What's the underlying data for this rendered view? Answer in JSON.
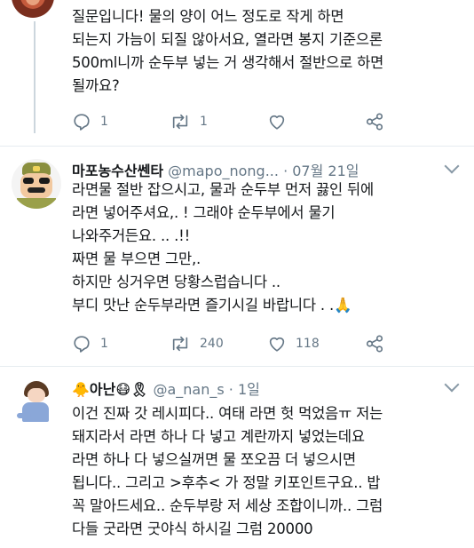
{
  "tweets": [
    {
      "text": "질문입니다! 물의 양이 어느 정도로 작게 하면\n되는지 가늠이 되질 않아서요, 열라면 봉지 기준으론\n500ml니까 순두부 넣는 거 생각해서 절반으로 하면\n될까요?",
      "actions": {
        "reply": "1",
        "retweet": "1",
        "like": ""
      }
    },
    {
      "display_name": "마포농수산쎈타",
      "handle": "@mapo_nong...",
      "dot": "·",
      "date": "07월 21일",
      "text": "라면물 절반 잡으시고, 물과 순두부 먼저 끓인 뒤에\n라면 넣어주셔요,. ! 그래야 순두부에서 물기\n나와주거든요. .. .!!\n짜면 물 부으면 그만,.\n하지만 싱거우면 당황스럽습니다 ..\n부디 맛난 순두부라면 즐기시길 바랍니다 . .🙏",
      "actions": {
        "reply": "1",
        "retweet": "240",
        "like": "118"
      }
    },
    {
      "display_name": "🐥아난😷🎗",
      "handle": "@a_nan_s",
      "dot": "·",
      "date": "1일",
      "text": "이건 진짜 갓 레시피다.. 여태 라면 헛 먹었음ㅠ 저는\n돼지라서 라면 하나 다 넣고 계란까지 넣었는데요\n라면 하나 다 넣으실꺼면 물 쪼오끔 더 넣으시면\n됩니다.. 그리고 >후추< 가 정말 키포인트구요.. 밥\n꼭 말아드세요.. 순두부랑 저 세상 조합이니까.. 그럼\n다들 굿라면 굿야식 하시길 그럼 20000"
    }
  ],
  "colors": {
    "icon": "#657786",
    "divider": "#e6ecf0",
    "text": "#14171a"
  }
}
